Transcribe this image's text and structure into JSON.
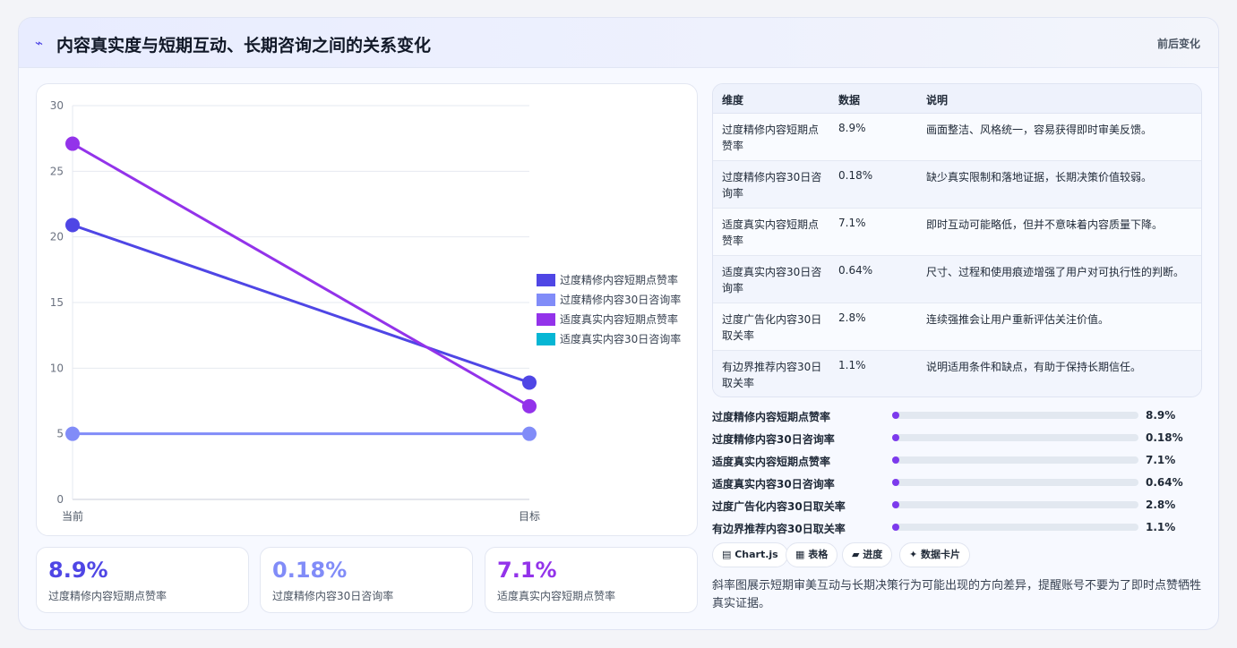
{
  "header": {
    "icon": "sparkline-icon",
    "title": "内容真实度与短期互动、长期咨询之间的关系变化",
    "tag": "前后变化"
  },
  "chart_data": {
    "type": "line",
    "title": "",
    "xlabel": "",
    "ylabel": "",
    "x": [
      "当前",
      "目标"
    ],
    "ylim": [
      0,
      30
    ],
    "yticks": [
      0,
      5,
      10,
      15,
      20,
      25,
      30
    ],
    "grid": true,
    "legend_position": "right",
    "series": [
      {
        "name": "过度精修内容短期点赞率",
        "values": [
          20.9,
          8.9
        ],
        "color": "#4f46e5"
      },
      {
        "name": "过度精修内容30日咨询率",
        "values": [
          5,
          5
        ],
        "color": "#818cf8"
      },
      {
        "name": "适度真实内容短期点赞率",
        "values": [
          27.1,
          7.1
        ],
        "color": "#9333ea"
      },
      {
        "name": "适度真实内容30日咨询率",
        "values": [],
        "color": "#06b6d4"
      }
    ]
  },
  "kpis": [
    {
      "value": "8.9%",
      "label": "过度精修内容短期点赞率",
      "color": "#4f46e5"
    },
    {
      "value": "0.18%",
      "label": "过度精修内容30日咨询率",
      "color": "#818cf8"
    },
    {
      "value": "7.1%",
      "label": "适度真实内容短期点赞率",
      "color": "#9333ea"
    }
  ],
  "table": {
    "headers": [
      "维度",
      "数据",
      "说明"
    ],
    "rows": [
      {
        "dim": "过度精修内容短期点赞率",
        "val": "8.9%",
        "desc": "画面整洁、风格统一，容易获得即时审美反馈。"
      },
      {
        "dim": "过度精修内容30日咨询率",
        "val": "0.18%",
        "desc": "缺少真实限制和落地证据，长期决策价值较弱。"
      },
      {
        "dim": "适度真实内容短期点赞率",
        "val": "7.1%",
        "desc": "即时互动可能略低，但并不意味着内容质量下降。"
      },
      {
        "dim": "适度真实内容30日咨询率",
        "val": "0.64%",
        "desc": "尺寸、过程和使用痕迹增强了用户对可执行性的判断。"
      },
      {
        "dim": "过度广告化内容30日取关率",
        "val": "2.8%",
        "desc": "连续强推会让用户重新评估关注价值。"
      },
      {
        "dim": "有边界推荐内容30日取关率",
        "val": "1.1%",
        "desc": "说明适用条件和缺点，有助于保持长期信任。"
      }
    ]
  },
  "progress": [
    {
      "label": "过度精修内容短期点赞率",
      "value": "8.9%",
      "fraction": 0.01
    },
    {
      "label": "过度精修内容30日咨询率",
      "value": "0.18%",
      "fraction": 0.01
    },
    {
      "label": "适度真实内容短期点赞率",
      "value": "7.1%",
      "fraction": 0.01
    },
    {
      "label": "适度真实内容30日咨询率",
      "value": "0.64%",
      "fraction": 0.01
    },
    {
      "label": "过度广告化内容30日取关率",
      "value": "2.8%",
      "fraction": 0.01
    },
    {
      "label": "有边界推荐内容30日取关率",
      "value": "1.1%",
      "fraction": 0.01
    }
  ],
  "chips": [
    "▤ Chart.js",
    "▦ 表格",
    "▰ 进度",
    "✦ 数据卡片"
  ],
  "note": "斜率图展示短期审美互动与长期决策行为可能出现的方向差异，提醒账号不要为了即时点赞牺牲真实证据。"
}
